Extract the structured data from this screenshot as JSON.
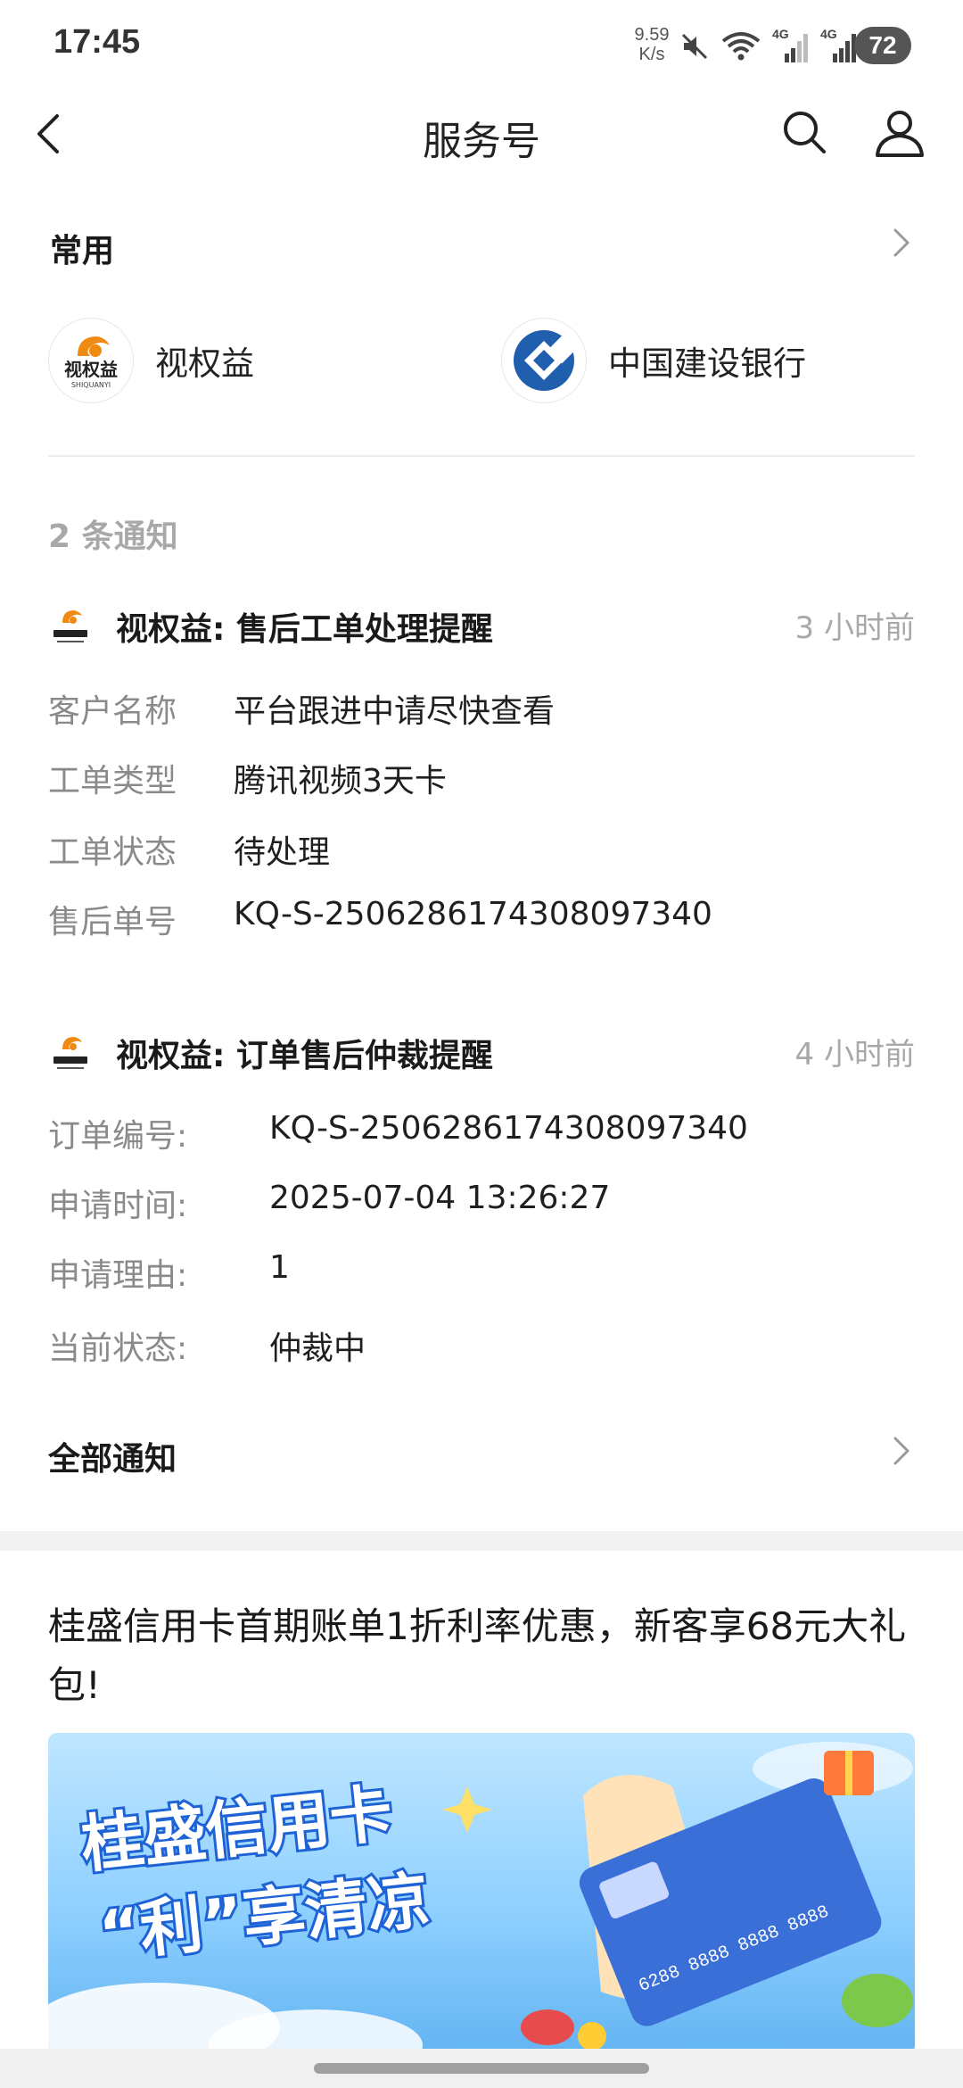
{
  "status_bar": {
    "time": "17:45",
    "net_speed_value": "9.59",
    "net_speed_unit": "K/s",
    "mute_icon": "mute-icon",
    "wifi_icon": "wifi-icon",
    "sim1_label": "4G",
    "sim2_label": "4G",
    "battery": "72"
  },
  "header": {
    "title": "服务号",
    "back_icon": "back-arrow-icon",
    "search_icon": "search-icon",
    "profile_icon": "user-icon"
  },
  "common": {
    "title": "常用",
    "services": [
      {
        "name": "视权益",
        "logo_text": "视权益",
        "logo_sub": "SHIQUANYI"
      },
      {
        "name": "中国建设银行"
      }
    ]
  },
  "notifications": {
    "count_label": "2 条通知",
    "items": [
      {
        "title": "视权益:  售后工单处理提醒",
        "time": "3 小时前",
        "fields": [
          {
            "key": "客户名称",
            "value": "平台跟进中请尽快查看"
          },
          {
            "key": "工单类型",
            "value": "腾讯视频3天卡"
          },
          {
            "key": "工单状态",
            "value": "待处理"
          },
          {
            "key": "售后单号",
            "value": "KQ-S-2506286174308097340"
          }
        ]
      },
      {
        "title": "视权益:  订单售后仲裁提醒",
        "time": "4 小时前",
        "fields": [
          {
            "key": "订单编号:",
            "value": "KQ-S-2506286174308097340"
          },
          {
            "key": "申请时间:",
            "value": "2025-07-04 13:26:27"
          },
          {
            "key": "申请理由:",
            "value": "1"
          },
          {
            "key": "当前状态:",
            "value": "仲裁中"
          }
        ]
      }
    ],
    "all_label": "全部通知"
  },
  "ad": {
    "title": "桂盛信用卡首期账单1折利率优惠，新客享68元大礼包!",
    "banner_line1": "桂盛信用卡",
    "banner_line2": "“利”享清凉",
    "card_number": "6288 8888 8888 8888"
  },
  "colors": {
    "muted": "#8a8a8a",
    "time_gray": "#a8a8a8",
    "ccb_blue": "#1f5fae",
    "logo_orange": "#f08a12"
  }
}
